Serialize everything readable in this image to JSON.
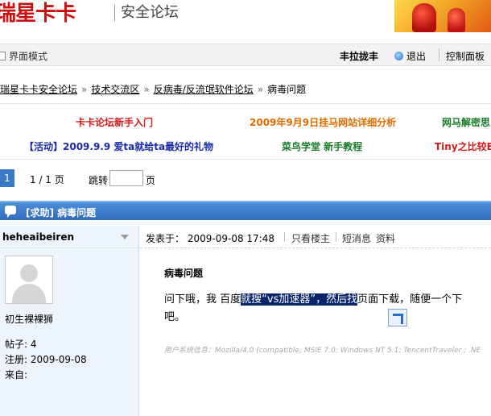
{
  "header": {
    "logo": "瑞星卡卡",
    "subtitle": "安全论坛"
  },
  "toolbar": {
    "mode": "界面模式",
    "user": "丰拉拢丰",
    "logout": "退出",
    "control_panel": "控制面板"
  },
  "breadcrumb": [
    "瑞星卡卡安全论坛",
    "技术交流区",
    "反病毒/反流氓软件论坛",
    "病毒问题"
  ],
  "announcements": {
    "row1": [
      "卡卡论坛新手入门",
      "2009年9月9日挂马网站详细分析",
      "网马解密思"
    ],
    "row2": [
      "【活动】2009.9.9 爱ta就给ta最好的礼物",
      "菜鸟学堂  新手教程",
      "Tiny之比较B"
    ]
  },
  "pager": {
    "current": "1",
    "info": "1 / 1 页",
    "jump": "跳转",
    "unit": "页"
  },
  "thread": {
    "title": "[求助] 病毒问题"
  },
  "author": {
    "name": "heheaibeiren",
    "rank": "初生裸裸狮",
    "posts": "帖子: 4",
    "registered": "注册: 2009-09-08",
    "from": "来自:"
  },
  "post": {
    "posted_label": "发表于：",
    "posted_time": "2009-09-08 17:48",
    "only_author": "只看楼主",
    "short_msg": "短消息",
    "profile": "资料",
    "title": "病毒问题",
    "line1_a": "问下哦，我  百度",
    "line1_hl": "就搜“vs加速器”，然后找",
    "line1_b": "页面下载，随便一个下",
    "line2": "吧。",
    "ua": "用户系统信息：Mozilla/4.0 (compatible; MSIE 7.0; Windows NT 5.1; TencentTraveler ; .NE"
  }
}
